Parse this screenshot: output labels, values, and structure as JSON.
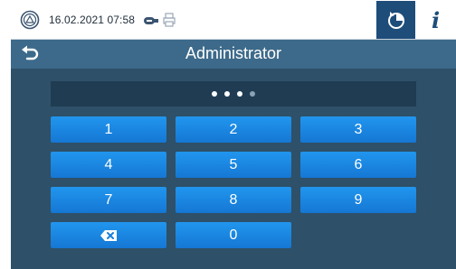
{
  "status": {
    "datetime": "16.02.2021  07:58",
    "icons": [
      "device-logo-icon",
      "usb-stick-icon",
      "printer-icon",
      "program-mode-icon",
      "info-icon"
    ],
    "info_label": "i"
  },
  "title": {
    "text": "Administrator",
    "back_icon": "back-arrow-icon"
  },
  "pin": {
    "entered": 3,
    "length": 4
  },
  "keypad": {
    "keys": [
      "1",
      "2",
      "3",
      "4",
      "5",
      "6",
      "7",
      "8",
      "9",
      "",
      "0"
    ],
    "backspace_icon": "backspace-icon"
  },
  "colors": {
    "background": "#2e5068",
    "titlebar": "#3d6a8a",
    "key": "#1c87e5",
    "accent": "#1e4d7a"
  }
}
